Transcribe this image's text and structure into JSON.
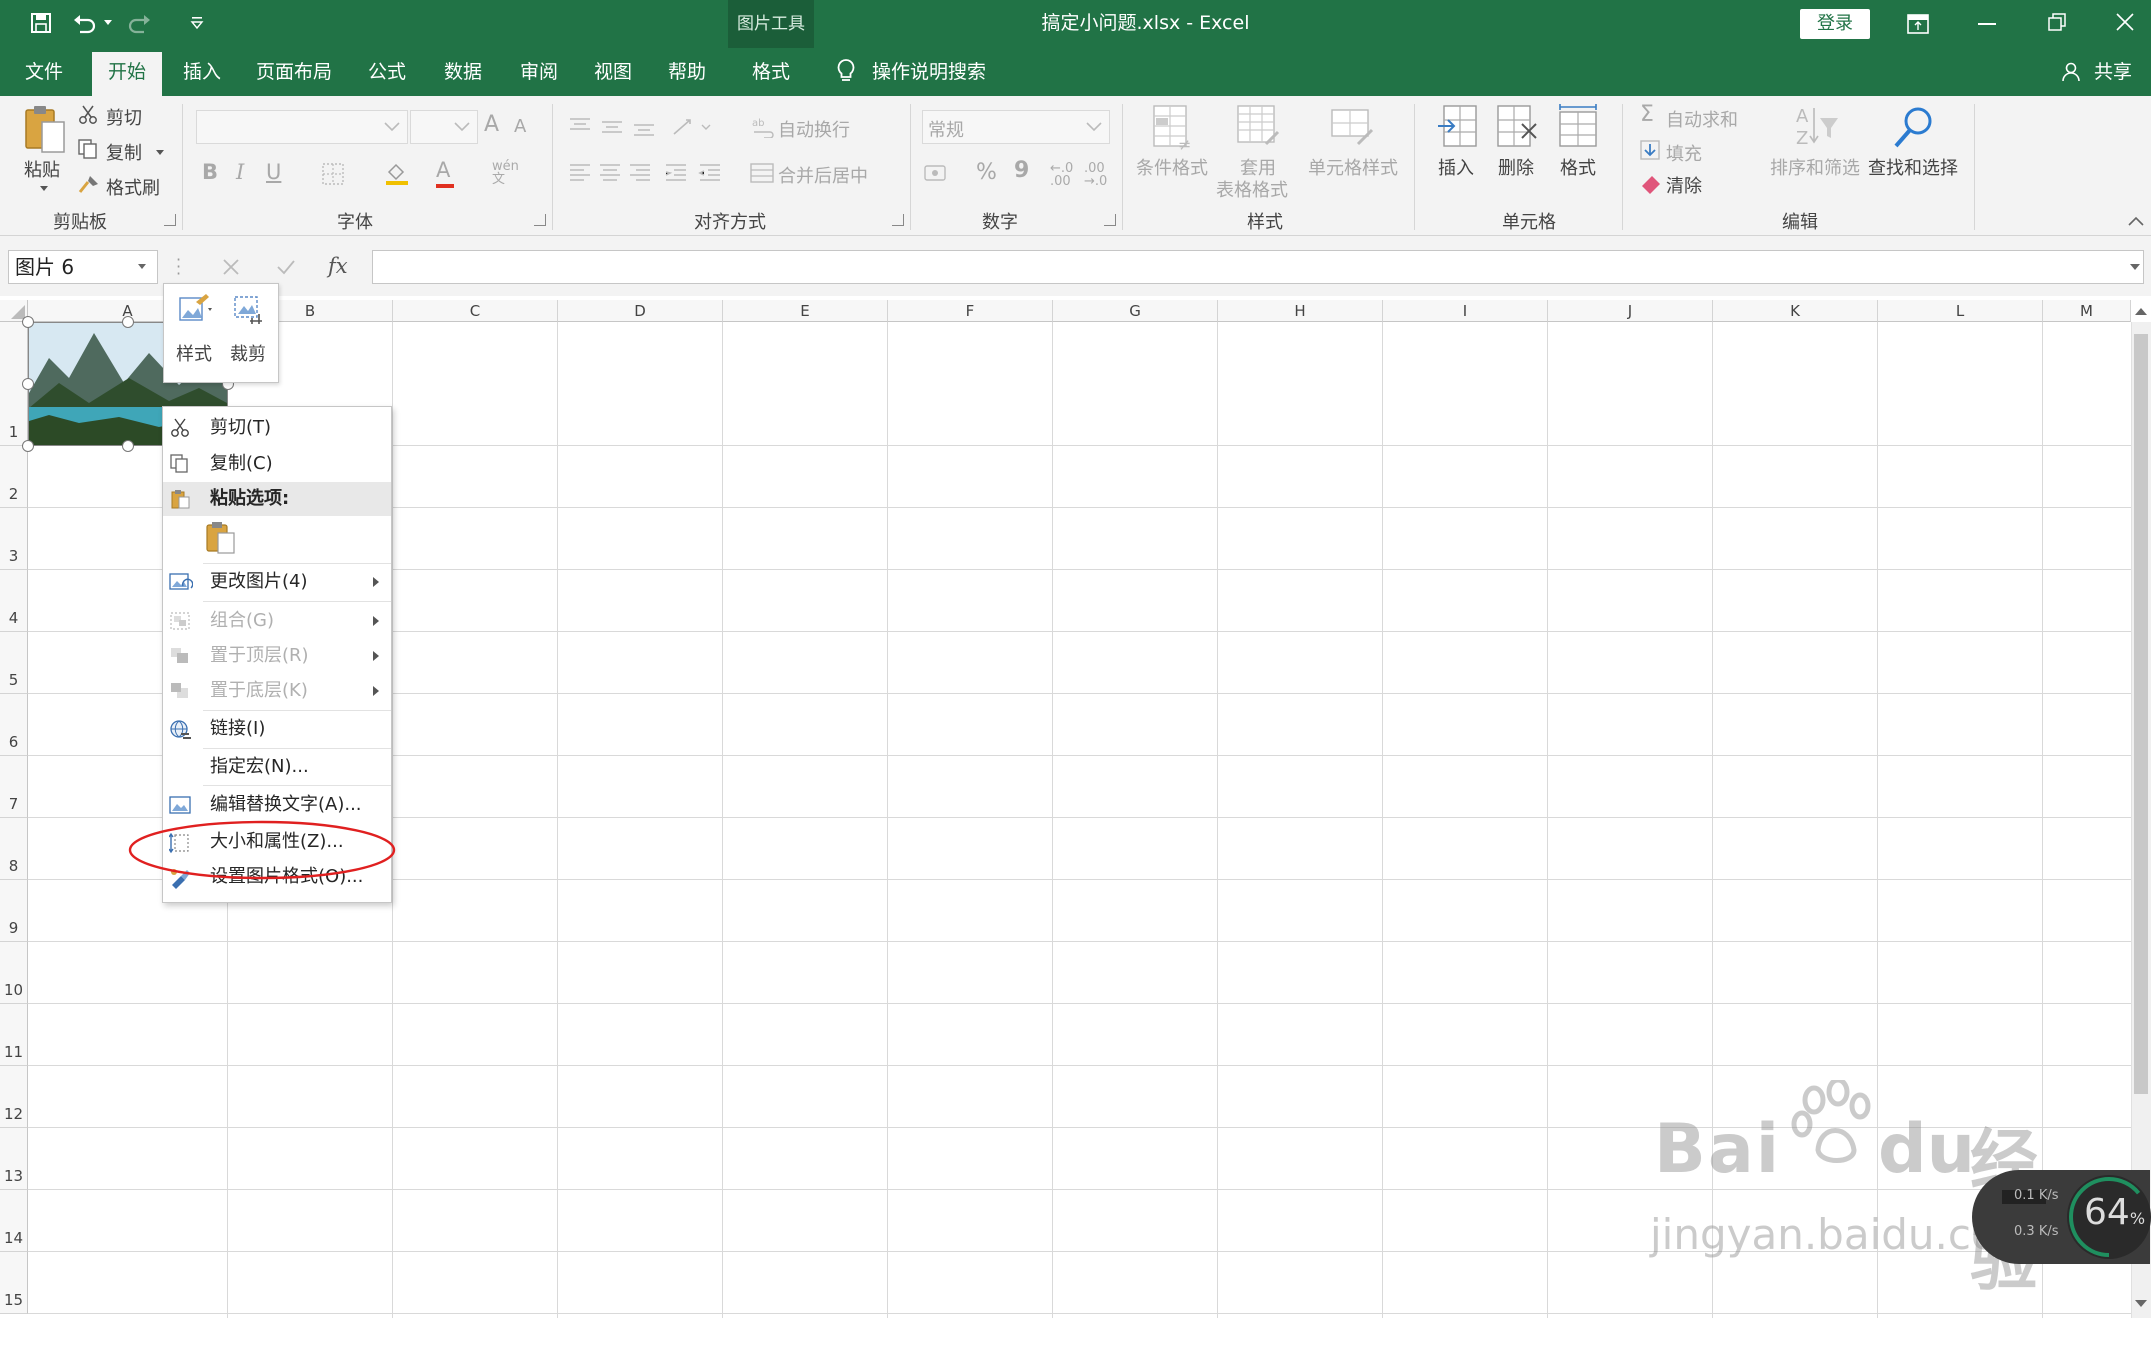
{
  "window": {
    "title": "搞定小问题.xlsx  -  Excel",
    "context_tab_group": "图片工具",
    "login": "登录",
    "share": "共享"
  },
  "tabs": [
    {
      "label": "文件",
      "active": false
    },
    {
      "label": "开始",
      "active": true
    },
    {
      "label": "插入",
      "active": false
    },
    {
      "label": "页面布局",
      "active": false
    },
    {
      "label": "公式",
      "active": false
    },
    {
      "label": "数据",
      "active": false
    },
    {
      "label": "审阅",
      "active": false
    },
    {
      "label": "视图",
      "active": false
    },
    {
      "label": "帮助",
      "active": false
    },
    {
      "label": "格式",
      "active": false
    }
  ],
  "tell_me": "操作说明搜索",
  "ribbon": {
    "clipboard": {
      "paste": "粘贴",
      "cut": "剪切",
      "copy": "复制",
      "format_painter": "格式刷",
      "group": "剪贴板"
    },
    "font": {
      "group": "字体",
      "grow": "A",
      "shrink": "A",
      "bold": "B",
      "italic": "I",
      "underline": "U",
      "font_color": "A"
    },
    "alignment": {
      "wrap": "自动换行",
      "merge": "合并后居中",
      "group": "对齐方式"
    },
    "number": {
      "format": "常规",
      "percent": "%",
      "comma": "9",
      "group": "数字"
    },
    "styles": {
      "conditional": "条件格式",
      "table_1": "套用",
      "table_2": "表格格式",
      "cell_styles": "单元格样式",
      "group": "样式"
    },
    "cells": {
      "insert": "插入",
      "delete": "删除",
      "format": "格式",
      "group": "单元格"
    },
    "editing": {
      "autosum": "自动求和",
      "fill": "填充",
      "clear": "清除",
      "sort": "排序和筛选",
      "find": "查找和选择",
      "group": "编辑"
    }
  },
  "formula_bar": {
    "name_box": "图片 6",
    "fx": "fx",
    "value": ""
  },
  "columns": [
    "A",
    "B",
    "C",
    "D",
    "E",
    "F",
    "G",
    "H",
    "I",
    "J",
    "K",
    "L",
    "M"
  ],
  "rows": [
    "1",
    "2",
    "3",
    "4",
    "5",
    "6",
    "7",
    "8",
    "9",
    "10",
    "11",
    "12",
    "13",
    "14",
    "15"
  ],
  "mini_toolbar": {
    "style": "样式",
    "crop": "裁剪"
  },
  "context_menu": {
    "cut": "剪切(T)",
    "copy": "复制(C)",
    "paste_options": "粘贴选项:",
    "change_picture": "更改图片(4)",
    "group": "组合(G)",
    "bring_front": "置于顶层(R)",
    "send_back": "置于底层(K)",
    "link": "链接(I)",
    "assign_macro": "指定宏(N)...",
    "alt_text": "编辑替换文字(A)...",
    "size_props": "大小和属性(Z)...",
    "format_picture": "设置图片格式(O)..."
  },
  "highlight_color": "#e02020",
  "watermark": {
    "brand": "Bai",
    "brand2": "du",
    "cn": "经验",
    "url": "jingyan.baidu.com"
  },
  "speed_widget": {
    "percent": "64",
    "unit": "%",
    "up": "0.1",
    "down": "0.3",
    "rate_unit": "K/s"
  }
}
